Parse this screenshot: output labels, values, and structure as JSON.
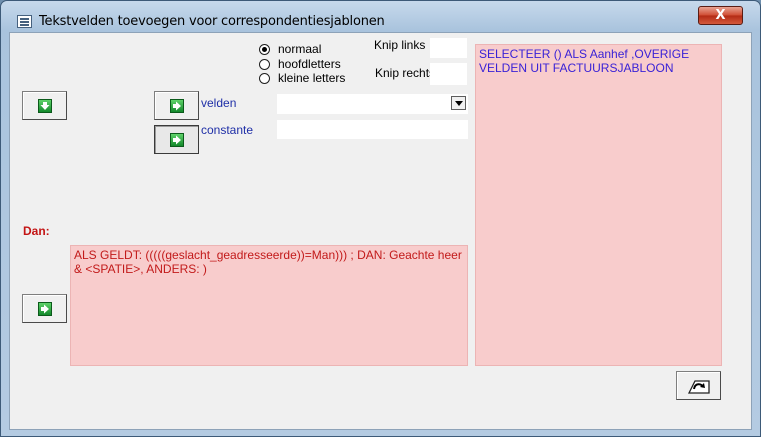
{
  "window": {
    "title": "Tekstvelden toevoegen voor correspondentiesjablonen",
    "close_label": "X"
  },
  "options": {
    "case_options": [
      {
        "label": "normaal",
        "checked": true
      },
      {
        "label": "hoofdletters",
        "checked": false
      },
      {
        "label": "kleine letters",
        "checked": false
      }
    ]
  },
  "knip": {
    "links_label": "Knip links",
    "links_value": "",
    "rechts_label": "Knip rechts",
    "rechts_value": ""
  },
  "velden": {
    "label": "velden",
    "selected_value": ""
  },
  "constante": {
    "label": "constante",
    "value": ""
  },
  "dan_label": "Dan:",
  "result_text": "SELECTEER () ALS Aanhef ,OVERIGE VELDEN UIT FACTUURSJABLOON",
  "condition_text": "ALS GELDT: (((((geslacht_geadresseerde))=Man))) ; DAN:  Geachte heer & <SPATIE>, ANDERS: )",
  "icons": {
    "down": "arrow-down-icon",
    "right": "arrow-right-icon",
    "undo": "undo-icon"
  },
  "colors": {
    "pink_bg": "#f8cccc",
    "label_blue": "#1f2fa7",
    "dan_red": "#c31414",
    "result_blue": "#3a22d6",
    "condition_red": "#c21a1a"
  }
}
